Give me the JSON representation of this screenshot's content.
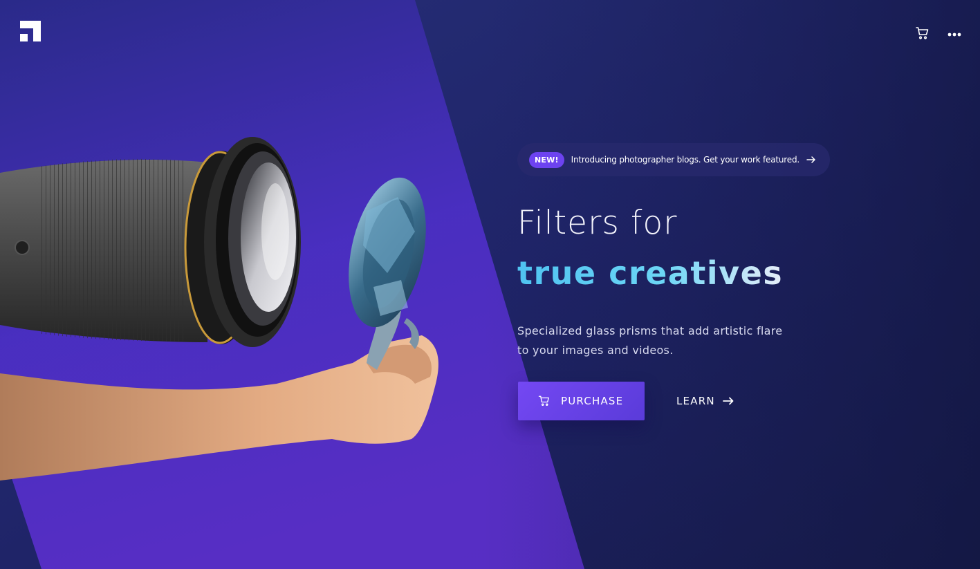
{
  "header": {
    "logo_icon": "brand-logo-icon",
    "cart_icon": "shopping-cart-icon",
    "menu_icon": "more-horizontal-icon"
  },
  "announcement": {
    "badge": "NEW!",
    "text": "Introducing photographer blogs. Get your work featured.",
    "arrow_icon": "arrow-right-icon"
  },
  "hero": {
    "title_line1": "Filters for",
    "title_line2": "true creatives",
    "subtitle_line1": "Specialized glass prisms that add artistic flare",
    "subtitle_line2": "to your images and videos.",
    "image_subject": "camera-lens-and-hand-holding-crystal"
  },
  "actions": {
    "purchase_label": "PURCHASE",
    "learn_label": "LEARN"
  },
  "colors": {
    "accent": "#6d43f0",
    "background_dark": "#1d2260",
    "background_purple": "#4a2bc0",
    "headline_gradient_start": "#4fc3f1",
    "headline_gradient_end": "#e8eef9"
  }
}
